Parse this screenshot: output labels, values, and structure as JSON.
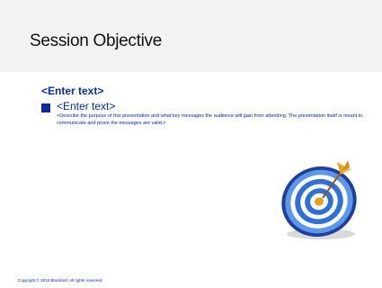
{
  "slide": {
    "title": "Session Objective",
    "heading": "<Enter text>",
    "bullet_text": "<Enter text>",
    "description": "<Describe the purpose of this presentation and what key messages the audience will gain from attending.  The presentation itself is meant to communicate and prove the messages are valid.>",
    "copyright": "Copyright © 2010 Blackbird.  All rights reserved."
  },
  "colors": {
    "accent": "#0b2a9e",
    "target_blue": "#2f6fd6",
    "dart_gold": "#e3a21a"
  },
  "icons": {
    "target": "target-icon",
    "dart": "dart-icon"
  }
}
